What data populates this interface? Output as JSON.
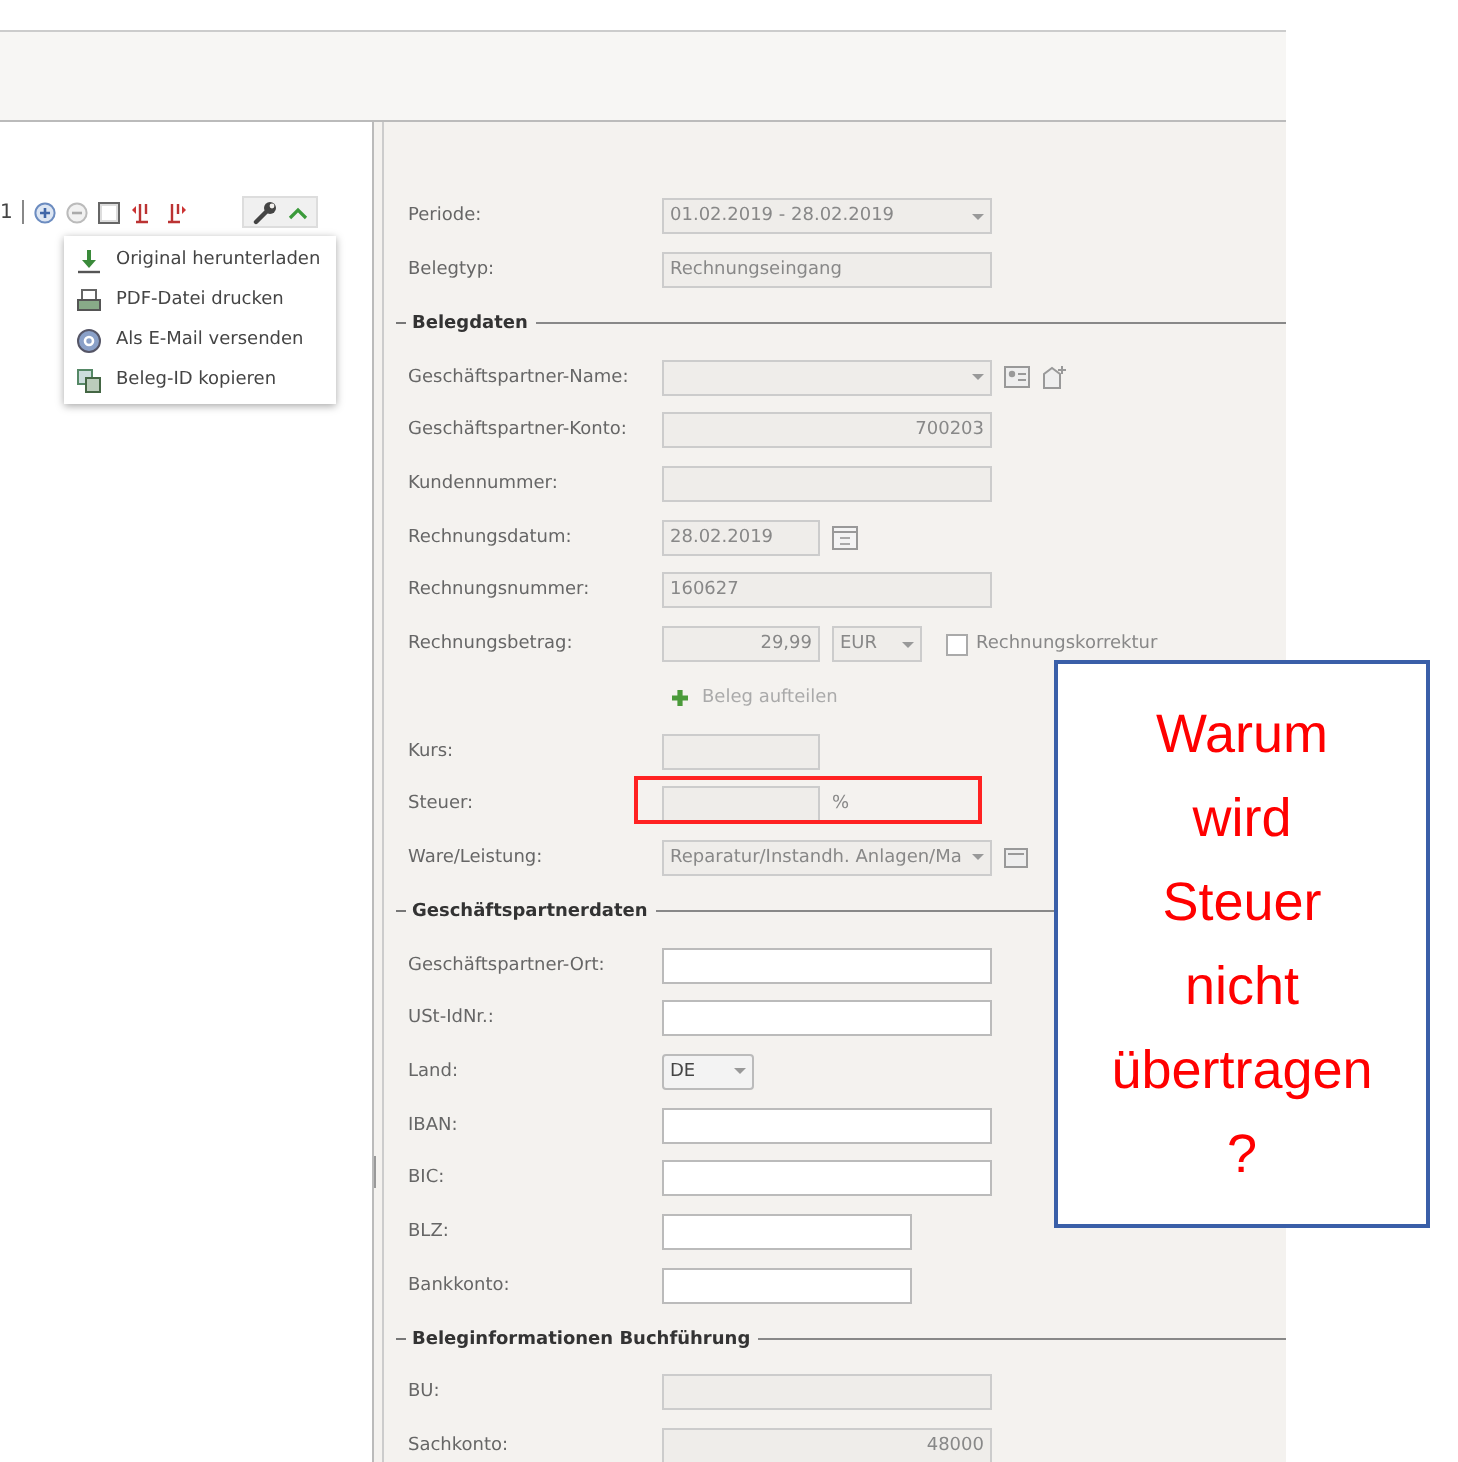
{
  "toolbar": {
    "page": "1"
  },
  "menu": [
    {
      "label": "Original herunterladen",
      "kind": "download"
    },
    {
      "label": "PDF-Datei drucken",
      "kind": "print"
    },
    {
      "label": "Als E-Mail versenden",
      "kind": "mail"
    },
    {
      "label": "Beleg-ID kopieren",
      "kind": "copy"
    }
  ],
  "sections": [
    {
      "rows": [
        {
          "label": "Periode:",
          "kind": "select",
          "value": "01.02.2019 - 28.02.2019",
          "disabled": true
        },
        {
          "label": "Belegtyp:",
          "kind": "text",
          "value": "Rechnungseingang",
          "disabled": true
        }
      ]
    },
    {
      "title": "Belegdaten",
      "rows": [
        {
          "label": "Geschäftspartner-Name:",
          "kind": "partner",
          "value": "",
          "disabled": true
        },
        {
          "label": "Geschäftspartner-Konto:",
          "kind": "number",
          "value": "700203",
          "disabled": true
        },
        {
          "label": "Kundennummer:",
          "kind": "text",
          "value": "",
          "disabled": true
        },
        {
          "label": "Rechnungsdatum:",
          "kind": "date",
          "value": "28.02.2019",
          "disabled": true
        },
        {
          "label": "Rechnungsnummer:",
          "kind": "text",
          "value": "160627",
          "disabled": true
        },
        {
          "label": "Rechnungsbetrag:",
          "kind": "amount",
          "value": "29,99",
          "currency": "EUR",
          "check_label": "Rechnungskorrektur",
          "checked": false,
          "disabled": true
        },
        {
          "label": "",
          "kind": "link",
          "value": "Beleg aufteilen",
          "disabled": true
        },
        {
          "label": "Kurs:",
          "kind": "short",
          "value": "",
          "disabled": true
        },
        {
          "label": "Steuer:",
          "kind": "short",
          "value": "",
          "unit": "%",
          "highlighted": true,
          "disabled": true
        },
        {
          "label": "Ware/Leistung:",
          "kind": "service",
          "value": "Reparatur/Instandh. Anlagen/Ma",
          "disabled": true
        }
      ]
    },
    {
      "title": "Geschäftspartnerdaten",
      "rows": [
        {
          "label": "Geschäftspartner-Ort:",
          "kind": "text",
          "value": "",
          "disabled": false
        },
        {
          "label": "USt-IdNr.:",
          "kind": "text",
          "value": "",
          "disabled": false
        },
        {
          "label": "Land:",
          "kind": "country",
          "value": "DE",
          "disabled": false
        },
        {
          "label": "IBAN:",
          "kind": "text",
          "value": "",
          "disabled": false
        },
        {
          "label": "BIC:",
          "kind": "text",
          "value": "",
          "disabled": false
        },
        {
          "label": "BLZ:",
          "kind": "medium",
          "value": "",
          "disabled": false
        },
        {
          "label": "Bankkonto:",
          "kind": "medium",
          "value": "",
          "disabled": false
        }
      ]
    },
    {
      "title": "Beleginformationen Buchführung",
      "rows": [
        {
          "label": "BU:",
          "kind": "text",
          "value": "",
          "disabled": true
        },
        {
          "label": "Sachkonto:",
          "kind": "number",
          "value": "48000",
          "disabled": true
        }
      ]
    }
  ],
  "callout": {
    "lines": [
      "Warum",
      "wird",
      "Steuer",
      "nicht",
      "übertragen",
      "?"
    ]
  }
}
